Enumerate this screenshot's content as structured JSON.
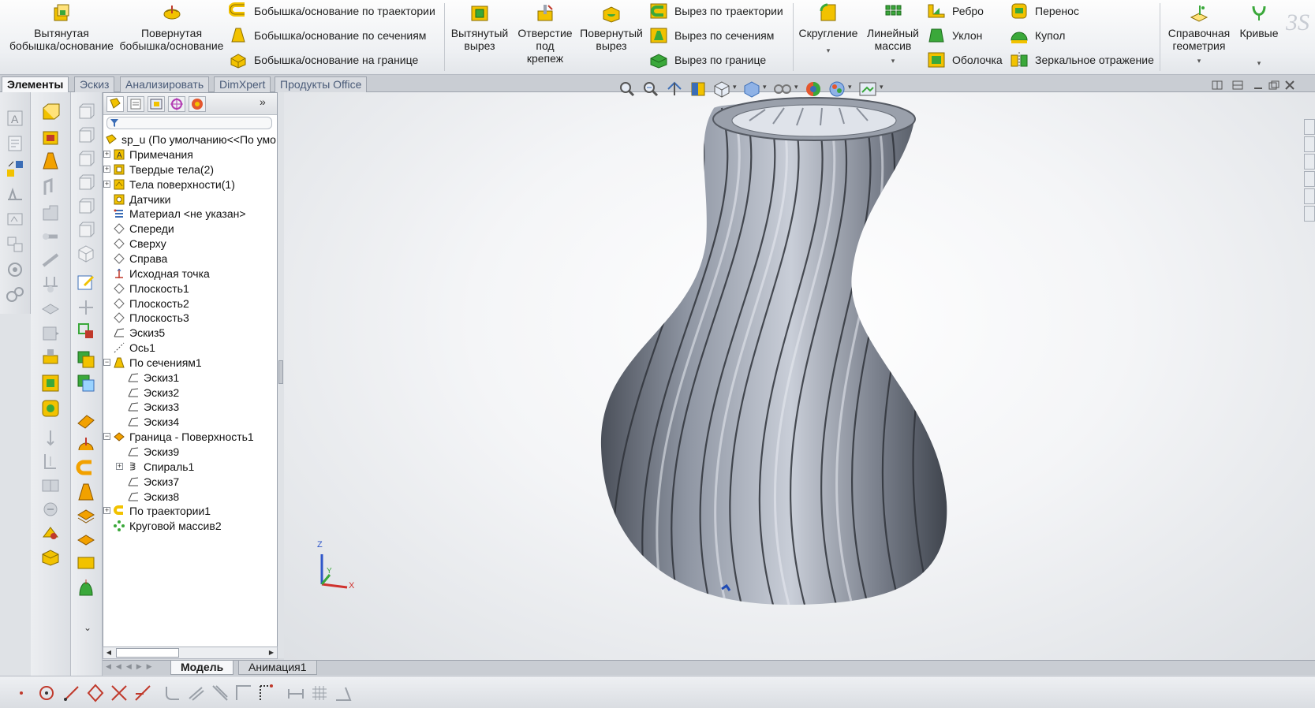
{
  "ribbon": {
    "extruded_boss": "Вытянутая\nбобышка/основание",
    "revolved_boss": "Повернутая\nбобышка/основание",
    "swept_boss": "Бобышка/основание по траектории",
    "lofted_boss": "Бобышка/основание по сечениям",
    "boundary_boss": "Бобышка/основание на границе",
    "extruded_cut": "Вытянутый\nвырез",
    "hole_wizard": "Отверстие\nпод\nкрепеж",
    "revolved_cut": "Повернутый\nвырез",
    "swept_cut": "Вырез по траектории",
    "lofted_cut": "Вырез по сечениям",
    "boundary_cut": "Вырез по границе",
    "fillet": "Скругление",
    "linear_pattern": "Линейный\nмассив",
    "rib": "Ребро",
    "draft": "Уклон",
    "shell": "Оболочка",
    "wrap": "Перенос",
    "dome": "Купол",
    "mirror": "Зеркальное отражение",
    "reference_geometry": "Справочная\nгеометрия",
    "curves": "Кривые",
    "dropdown_glyph": "▾"
  },
  "tabs": [
    "Элементы",
    "Эскиз",
    "Анализировать",
    "DimXpert",
    "Продукты Office"
  ],
  "tree": {
    "expand_glyph": "»",
    "root": "sp_u  (По умолчанию<<По умо",
    "items": [
      "Примечания",
      "Твердые тела(2)",
      "Тела поверхности(1)",
      "Датчики",
      "Материал <не указан>",
      "Спереди",
      "Сверху",
      "Справа",
      "Исходная точка",
      "Плоскость1",
      "Плоскость2",
      "Плоскость3",
      "Эскиз5",
      "Ось1",
      "По сечениям1",
      "Эскиз1",
      "Эскиз2",
      "Эскиз3",
      "Эскиз4",
      "Граница - Поверхность1",
      "Эскиз9",
      "Спираль1",
      "Эскиз7",
      "Эскиз8",
      "По траектории1",
      "Круговой массив2"
    ]
  },
  "triad": {
    "z": "Z",
    "y": "Y",
    "x": "X"
  },
  "bottom_tabs": [
    "Модель",
    "Анимация1"
  ],
  "colors": {
    "accent_blue": "#3b6db6",
    "vase_shade": "#8f96a3",
    "icon_yellow": "#f2c200",
    "icon_green": "#3aa83a"
  }
}
